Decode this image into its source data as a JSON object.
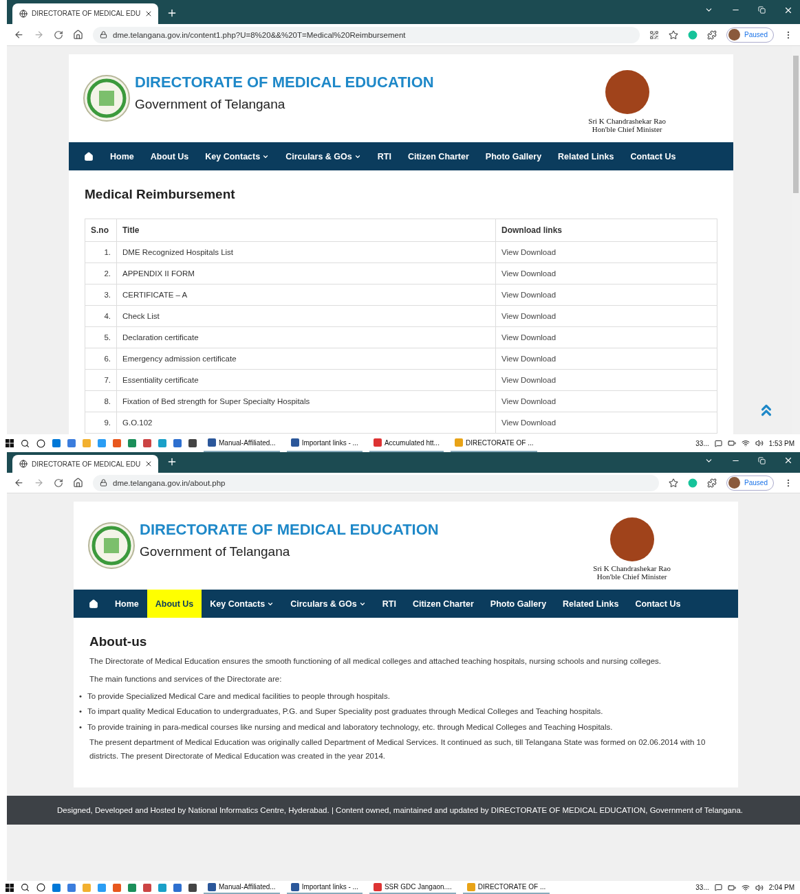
{
  "screens": [
    {
      "tab": {
        "title": "DIRECTORATE OF MEDICAL EDU"
      },
      "url": "dme.telangana.gov.in/content1.php?U=8%20&&%20T=Medical%20Reimbursement",
      "qr_button": true,
      "profile": "Paused",
      "scrollbar": true,
      "scroll_top_button": true,
      "header": {
        "title": "DIRECTORATE OF MEDICAL EDUCATION",
        "subtitle": "Government of Telangana",
        "cm_name": "Sri K Chandrashekar Rao",
        "cm_role": "Hon'ble Chief Minister"
      },
      "nav": [
        {
          "label": "Home",
          "dropdown": false,
          "selected": false
        },
        {
          "label": "About Us",
          "dropdown": false,
          "selected": false
        },
        {
          "label": "Key Contacts",
          "dropdown": true,
          "selected": false
        },
        {
          "label": "Circulars & GOs",
          "dropdown": true,
          "selected": false
        },
        {
          "label": "RTI",
          "dropdown": false,
          "selected": false
        },
        {
          "label": "Citizen Charter",
          "dropdown": false,
          "selected": false
        },
        {
          "label": "Photo Gallery",
          "dropdown": false,
          "selected": false
        },
        {
          "label": "Related Links",
          "dropdown": false,
          "selected": false
        },
        {
          "label": "Contact Us",
          "dropdown": false,
          "selected": false
        }
      ],
      "content": {
        "kind": "table",
        "heading": "Medical Reimbursement",
        "columns": [
          "S.no",
          "Title",
          "Download links"
        ],
        "rows": [
          {
            "no": "1.",
            "title": "DME Recognized Hospitals List",
            "link": "View Download"
          },
          {
            "no": "2.",
            "title": "APPENDIX II FORM",
            "link": "View Download"
          },
          {
            "no": "3.",
            "title": "CERTIFICATE – A",
            "link": "View Download"
          },
          {
            "no": "4.",
            "title": "Check List",
            "link": "View Download"
          },
          {
            "no": "5.",
            "title": "Declaration certificate",
            "link": "View Download"
          },
          {
            "no": "6.",
            "title": "Emergency admission certificate",
            "link": "View Download"
          },
          {
            "no": "7.",
            "title": "Essentiality certificate",
            "link": "View Download"
          },
          {
            "no": "8.",
            "title": "Fixation of Bed strength for Super Specialty Hospitals",
            "link": "View Download"
          },
          {
            "no": "9.",
            "title": "G.O.102",
            "link": "View Download"
          }
        ]
      },
      "taskbar": {
        "apps": [
          {
            "kind": "word",
            "label": "Manual-Affiliated..."
          },
          {
            "kind": "word",
            "label": "Important links - ..."
          },
          {
            "kind": "pdf",
            "label": "Accumulated htt..."
          },
          {
            "kind": "chrome",
            "label": "DIRECTORATE OF ..."
          }
        ],
        "tray": "33...",
        "time": "1:53 PM"
      }
    },
    {
      "tab": {
        "title": "DIRECTORATE OF MEDICAL EDU"
      },
      "url": "dme.telangana.gov.in/about.php",
      "qr_button": false,
      "profile": "Paused",
      "scrollbar": false,
      "scroll_top_button": false,
      "header": {
        "title": "DIRECTORATE OF MEDICAL EDUCATION",
        "subtitle": "Government of Telangana",
        "cm_name": "Sri K Chandrashekar Rao",
        "cm_role": "Hon'ble Chief Minister"
      },
      "nav": [
        {
          "label": "Home",
          "dropdown": false,
          "selected": false
        },
        {
          "label": "About Us",
          "dropdown": false,
          "selected": true
        },
        {
          "label": "Key Contacts",
          "dropdown": true,
          "selected": false
        },
        {
          "label": "Circulars & GOs",
          "dropdown": true,
          "selected": false
        },
        {
          "label": "RTI",
          "dropdown": false,
          "selected": false
        },
        {
          "label": "Citizen Charter",
          "dropdown": false,
          "selected": false
        },
        {
          "label": "Photo Gallery",
          "dropdown": false,
          "selected": false
        },
        {
          "label": "Related Links",
          "dropdown": false,
          "selected": false
        },
        {
          "label": "Contact Us",
          "dropdown": false,
          "selected": false
        }
      ],
      "content": {
        "kind": "about",
        "heading": "About-us",
        "blocks": [
          {
            "kind": "para",
            "text": "The Directorate of Medical Education ensures the smooth functioning of all medical colleges and attached teaching hospitals, nursing schools and nursing colleges."
          },
          {
            "kind": "para",
            "text": "The main functions and services of the Directorate are:"
          },
          {
            "kind": "bullet",
            "marker": "•",
            "text": "To provide Specialized Medical Care and medical facilities to people through hospitals."
          },
          {
            "kind": "bullet",
            "marker": "•",
            "text": "To impart quality Medical Education to undergraduates, P.G. and Super Speciality post graduates through Medical Colleges and Teaching hospitals."
          },
          {
            "kind": "bullet",
            "marker": "•",
            "text": "To provide training in para-medical courses like nursing and medical and laboratory technology, etc. through Medical Colleges and Teaching Hospitals."
          },
          {
            "kind": "para",
            "text": "The present department of Medical Education was originally called Department of Medical Services. It continued as such, till Telangana State was formed on 02.06.2014 with 10 districts. The present Directorate of Medical Education was created in the year 2014."
          }
        ]
      },
      "footer": "Designed, Developed and Hosted by National Informatics Centre, Hyderabad. | Content owned, maintained and updated by DIRECTORATE OF MEDICAL EDUCATION, Government of Telangana.",
      "taskbar": {
        "apps": [
          {
            "kind": "word",
            "label": "Manual-Affiliated..."
          },
          {
            "kind": "word",
            "label": "Important links - ..."
          },
          {
            "kind": "pdf",
            "label": "SSR GDC Jangaon...."
          },
          {
            "kind": "chrome",
            "label": "DIRECTORATE OF ..."
          }
        ],
        "tray": "33...",
        "time": "2:04 PM"
      }
    }
  ]
}
